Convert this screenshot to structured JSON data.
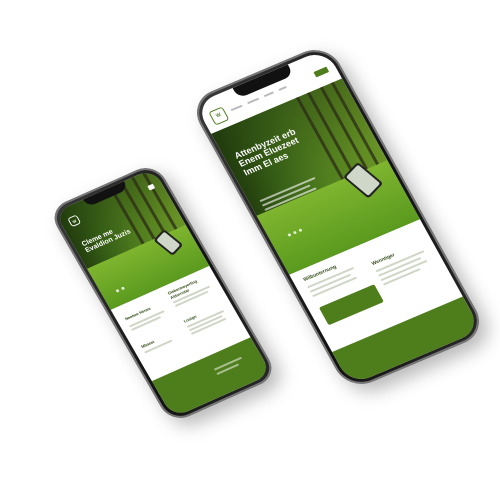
{
  "tablet": {
    "logo_text": "W",
    "nav_links": [
      "",
      "",
      "",
      "",
      ""
    ],
    "hero_title": "Attenbyzeit erb Enem Eluezeet Imm El aes",
    "section1_title": "Wilbunternung",
    "section2_title": "Wenntiger",
    "accent_color": "#4e7d1c"
  },
  "phone": {
    "logo_text": "W",
    "hero_title": "Cleme me Evaldion Juzis",
    "card1_title": "Neebee Henee",
    "card2_title": "Glebermeyerling Aldornstar",
    "card3_title": "Mbaset",
    "card4_title": "Lostgn",
    "accent_color": "#4e7d1c"
  }
}
